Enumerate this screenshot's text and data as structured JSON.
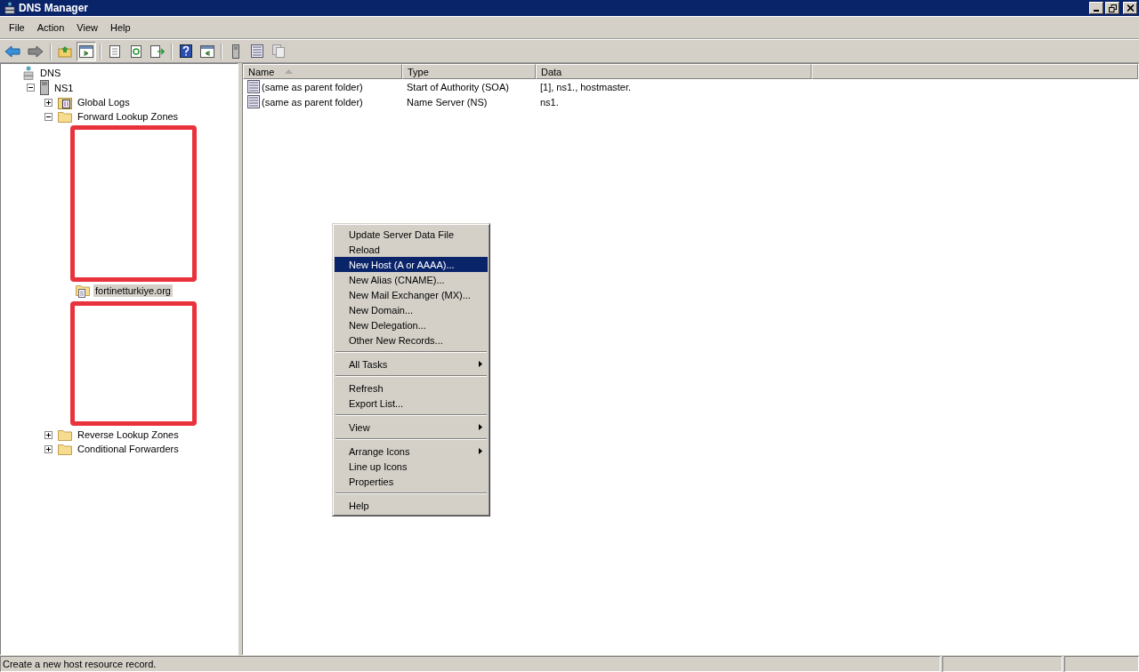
{
  "window": {
    "title": "DNS Manager"
  },
  "menu_bar": [
    "File",
    "Action",
    "View",
    "Help"
  ],
  "tree": [
    {
      "label": "DNS",
      "kind": "root",
      "selected": false,
      "children": [
        {
          "label": "NS1",
          "kind": "server",
          "expanded": true,
          "selected": false,
          "children": [
            {
              "label": "Global Logs",
              "kind": "logs",
              "expanded": false,
              "selected": false
            },
            {
              "label": "Forward Lookup Zones",
              "kind": "folder",
              "expanded": true,
              "selected": false,
              "children": [
                {
                  "kind": "redacted"
                },
                {
                  "label": "fortinetturkiye.org",
                  "kind": "zone",
                  "selected": true
                },
                {
                  "kind": "redacted"
                }
              ]
            },
            {
              "label": "Reverse Lookup Zones",
              "kind": "folder",
              "expanded": false,
              "selected": false
            },
            {
              "label": "Conditional Forwarders",
              "kind": "folder",
              "expanded": false,
              "selected": false
            }
          ]
        }
      ]
    }
  ],
  "table": {
    "columns": [
      {
        "label": "Name",
        "sorted": true
      },
      {
        "label": "Type",
        "sorted": false
      },
      {
        "label": "Data",
        "sorted": false
      }
    ],
    "rows": [
      [
        "(same as parent folder)",
        "Start of Authority (SOA)",
        "[1], ns1., hostmaster."
      ],
      [
        "(same as parent folder)",
        "Name Server (NS)",
        "ns1."
      ]
    ]
  },
  "context_menu": [
    {
      "kind": "item",
      "label": "Update Server Data File",
      "selected": false,
      "submenu": false
    },
    {
      "kind": "item",
      "label": "Reload",
      "selected": false,
      "submenu": false
    },
    {
      "kind": "item",
      "label": "New Host (A or AAAA)...",
      "selected": true,
      "submenu": false
    },
    {
      "kind": "item",
      "label": "New Alias (CNAME)...",
      "selected": false,
      "submenu": false
    },
    {
      "kind": "item",
      "label": "New Mail Exchanger (MX)...",
      "selected": false,
      "submenu": false
    },
    {
      "kind": "item",
      "label": "New Domain...",
      "selected": false,
      "submenu": false
    },
    {
      "kind": "item",
      "label": "New Delegation...",
      "selected": false,
      "submenu": false
    },
    {
      "kind": "item",
      "label": "Other New Records...",
      "selected": false,
      "submenu": false
    },
    {
      "kind": "separator"
    },
    {
      "kind": "item",
      "label": "All Tasks",
      "selected": false,
      "submenu": true
    },
    {
      "kind": "separator"
    },
    {
      "kind": "item",
      "label": "Refresh",
      "selected": false,
      "submenu": false
    },
    {
      "kind": "item",
      "label": "Export List...",
      "selected": false,
      "submenu": false
    },
    {
      "kind": "separator"
    },
    {
      "kind": "item",
      "label": "View",
      "selected": false,
      "submenu": true
    },
    {
      "kind": "separator"
    },
    {
      "kind": "item",
      "label": "Arrange Icons",
      "selected": false,
      "submenu": true
    },
    {
      "kind": "item",
      "label": "Line up Icons",
      "selected": false,
      "submenu": false
    },
    {
      "kind": "item",
      "label": "Properties",
      "selected": false,
      "submenu": false
    },
    {
      "kind": "separator"
    },
    {
      "kind": "item",
      "label": "Help",
      "selected": false,
      "submenu": false
    }
  ],
  "status_bar": {
    "text": "Create a new host resource record."
  }
}
